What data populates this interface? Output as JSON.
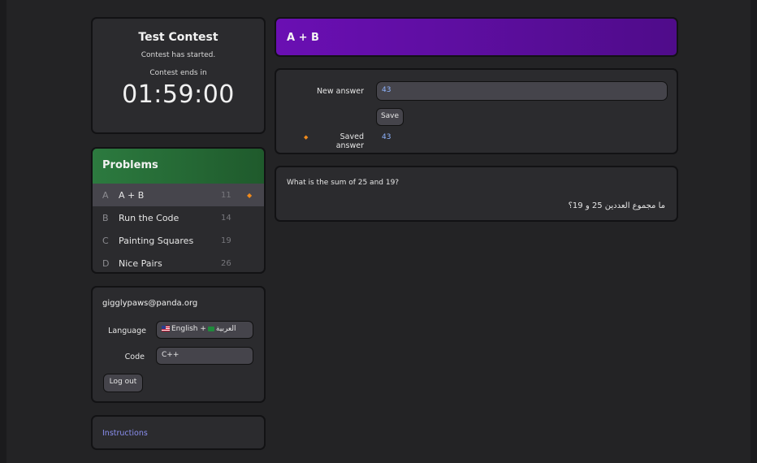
{
  "contest": {
    "title": "Test Contest",
    "status": "Contest has started.",
    "ends_label": "Contest ends in",
    "timer": "01:59:00"
  },
  "problems": {
    "heading": "Problems",
    "items": [
      {
        "letter": "A",
        "name": "A + B",
        "points": "11",
        "answered": true
      },
      {
        "letter": "B",
        "name": "Run the Code",
        "points": "14",
        "answered": false
      },
      {
        "letter": "C",
        "name": "Painting Squares",
        "points": "19",
        "answered": false
      },
      {
        "letter": "D",
        "name": "Nice Pairs",
        "points": "26",
        "answered": false
      }
    ]
  },
  "user": {
    "email": "gigglypaws@panda.org",
    "language_label": "Language",
    "language_value_en": "English +",
    "language_value_ar": "العربية",
    "code_label": "Code",
    "code_value": "C++",
    "logout_label": "Log out"
  },
  "links": {
    "instructions": "Instructions"
  },
  "problem": {
    "title": "A + B",
    "new_answer_label": "New answer",
    "new_answer_value": "43",
    "save_label": "Save",
    "saved_answer_label": "Saved answer",
    "saved_answer_value": "43",
    "statement_en": "What is the sum of 25 and 19?",
    "statement_ar": "ما مجموع العددين 25 و 19؟"
  },
  "colors": {
    "title_bar": "#6a0fb3",
    "problems_header": "#2c7a3f",
    "answer_value": "#8fb4ff",
    "marker": "#f08a1c",
    "link": "#8a8ff0"
  }
}
